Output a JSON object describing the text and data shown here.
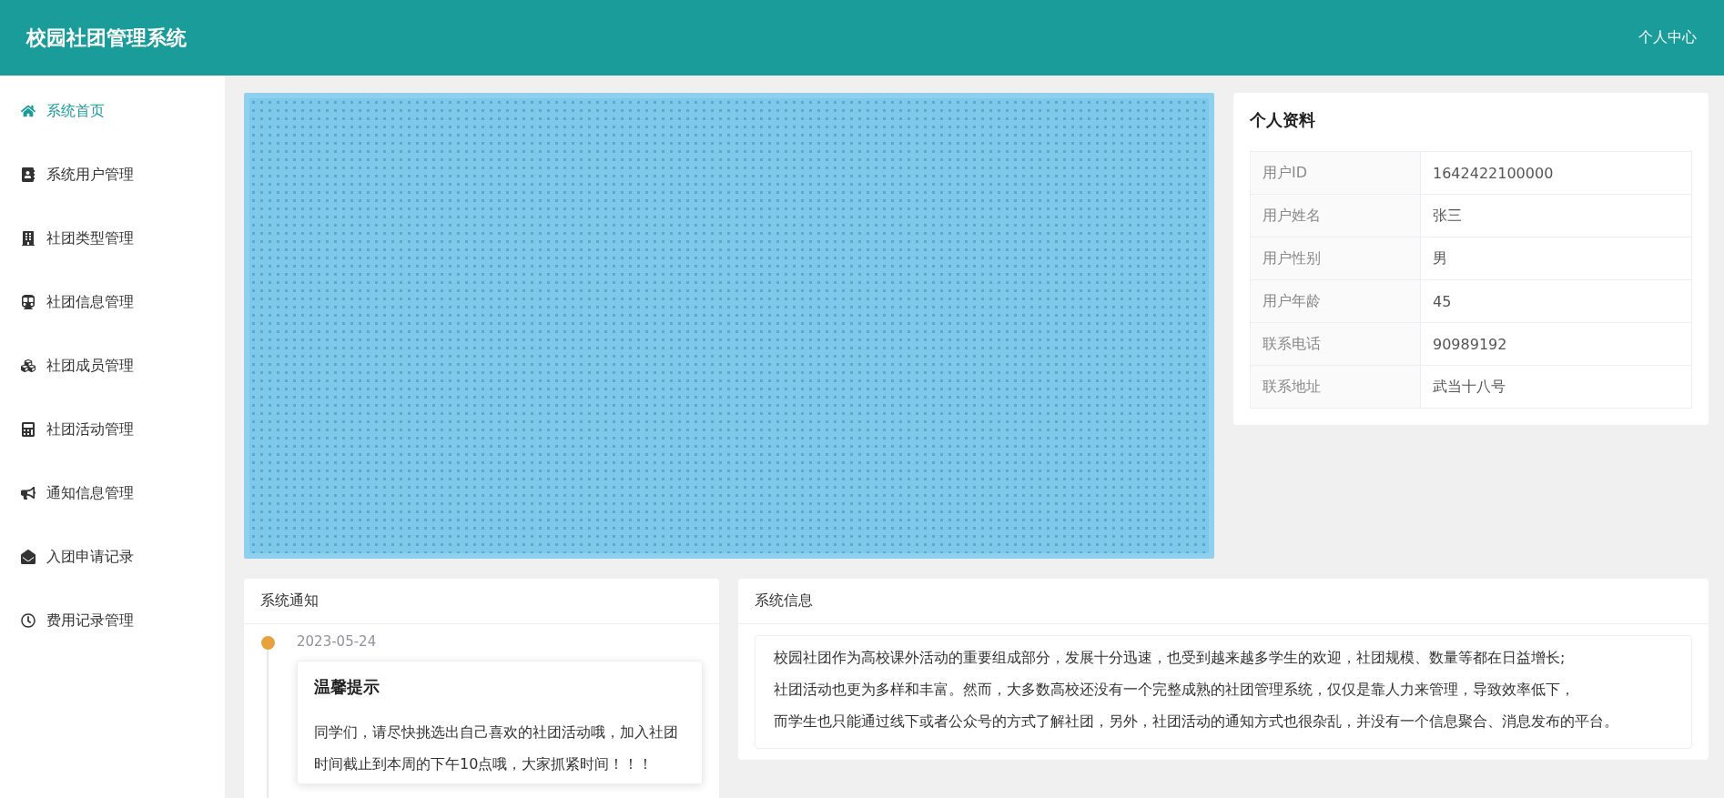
{
  "header": {
    "title": "校园社团管理系统",
    "user_menu": "个人中心"
  },
  "sidebar": {
    "items": [
      {
        "label": "系统首页",
        "selected": true
      },
      {
        "label": "系统用户管理",
        "selected": false
      },
      {
        "label": "社团类型管理",
        "selected": false
      },
      {
        "label": "社团信息管理",
        "selected": false
      },
      {
        "label": "社团成员管理",
        "selected": false
      },
      {
        "label": "社团活动管理",
        "selected": false
      },
      {
        "label": "通知信息管理",
        "selected": false
      },
      {
        "label": "入团申请记录",
        "selected": false
      },
      {
        "label": "费用记录管理",
        "selected": false
      }
    ]
  },
  "profile": {
    "title": "个人资料",
    "rows": [
      {
        "label": "用户ID",
        "value": "1642422100000"
      },
      {
        "label": "用户姓名",
        "value": "张三"
      },
      {
        "label": "用户性别",
        "value": "男"
      },
      {
        "label": "用户年龄",
        "value": "45"
      },
      {
        "label": "联系电话",
        "value": "90989192"
      },
      {
        "label": "联系地址",
        "value": "武当十八号"
      }
    ]
  },
  "notices": {
    "title": "系统通知",
    "items": [
      {
        "date": "2023-05-24",
        "title": "温馨提示",
        "body": "同学们，请尽快挑选出自己喜欢的社团活动哦，加入社团时间截止到本周的下午10点哦，大家抓紧时间！！！"
      }
    ]
  },
  "system_info": {
    "title": "系统信息",
    "paragraphs": [
      "校园社团作为高校课外活动的重要组成部分，发展十分迅速，也受到越来越多学生的欢迎，社团规模、数量等都在日益增长;",
      "社团活动也更为多样和丰富。然而，大多数高校还没有一个完整成熟的社团管理系统，仅仅是靠人力来管理，导致效率低下，",
      "而学生也只能通过线下或者公众号的方式了解社团，另外，社团活动的通知方式也很杂乱，并没有一个信息聚合、消息发布的平台。"
    ]
  }
}
